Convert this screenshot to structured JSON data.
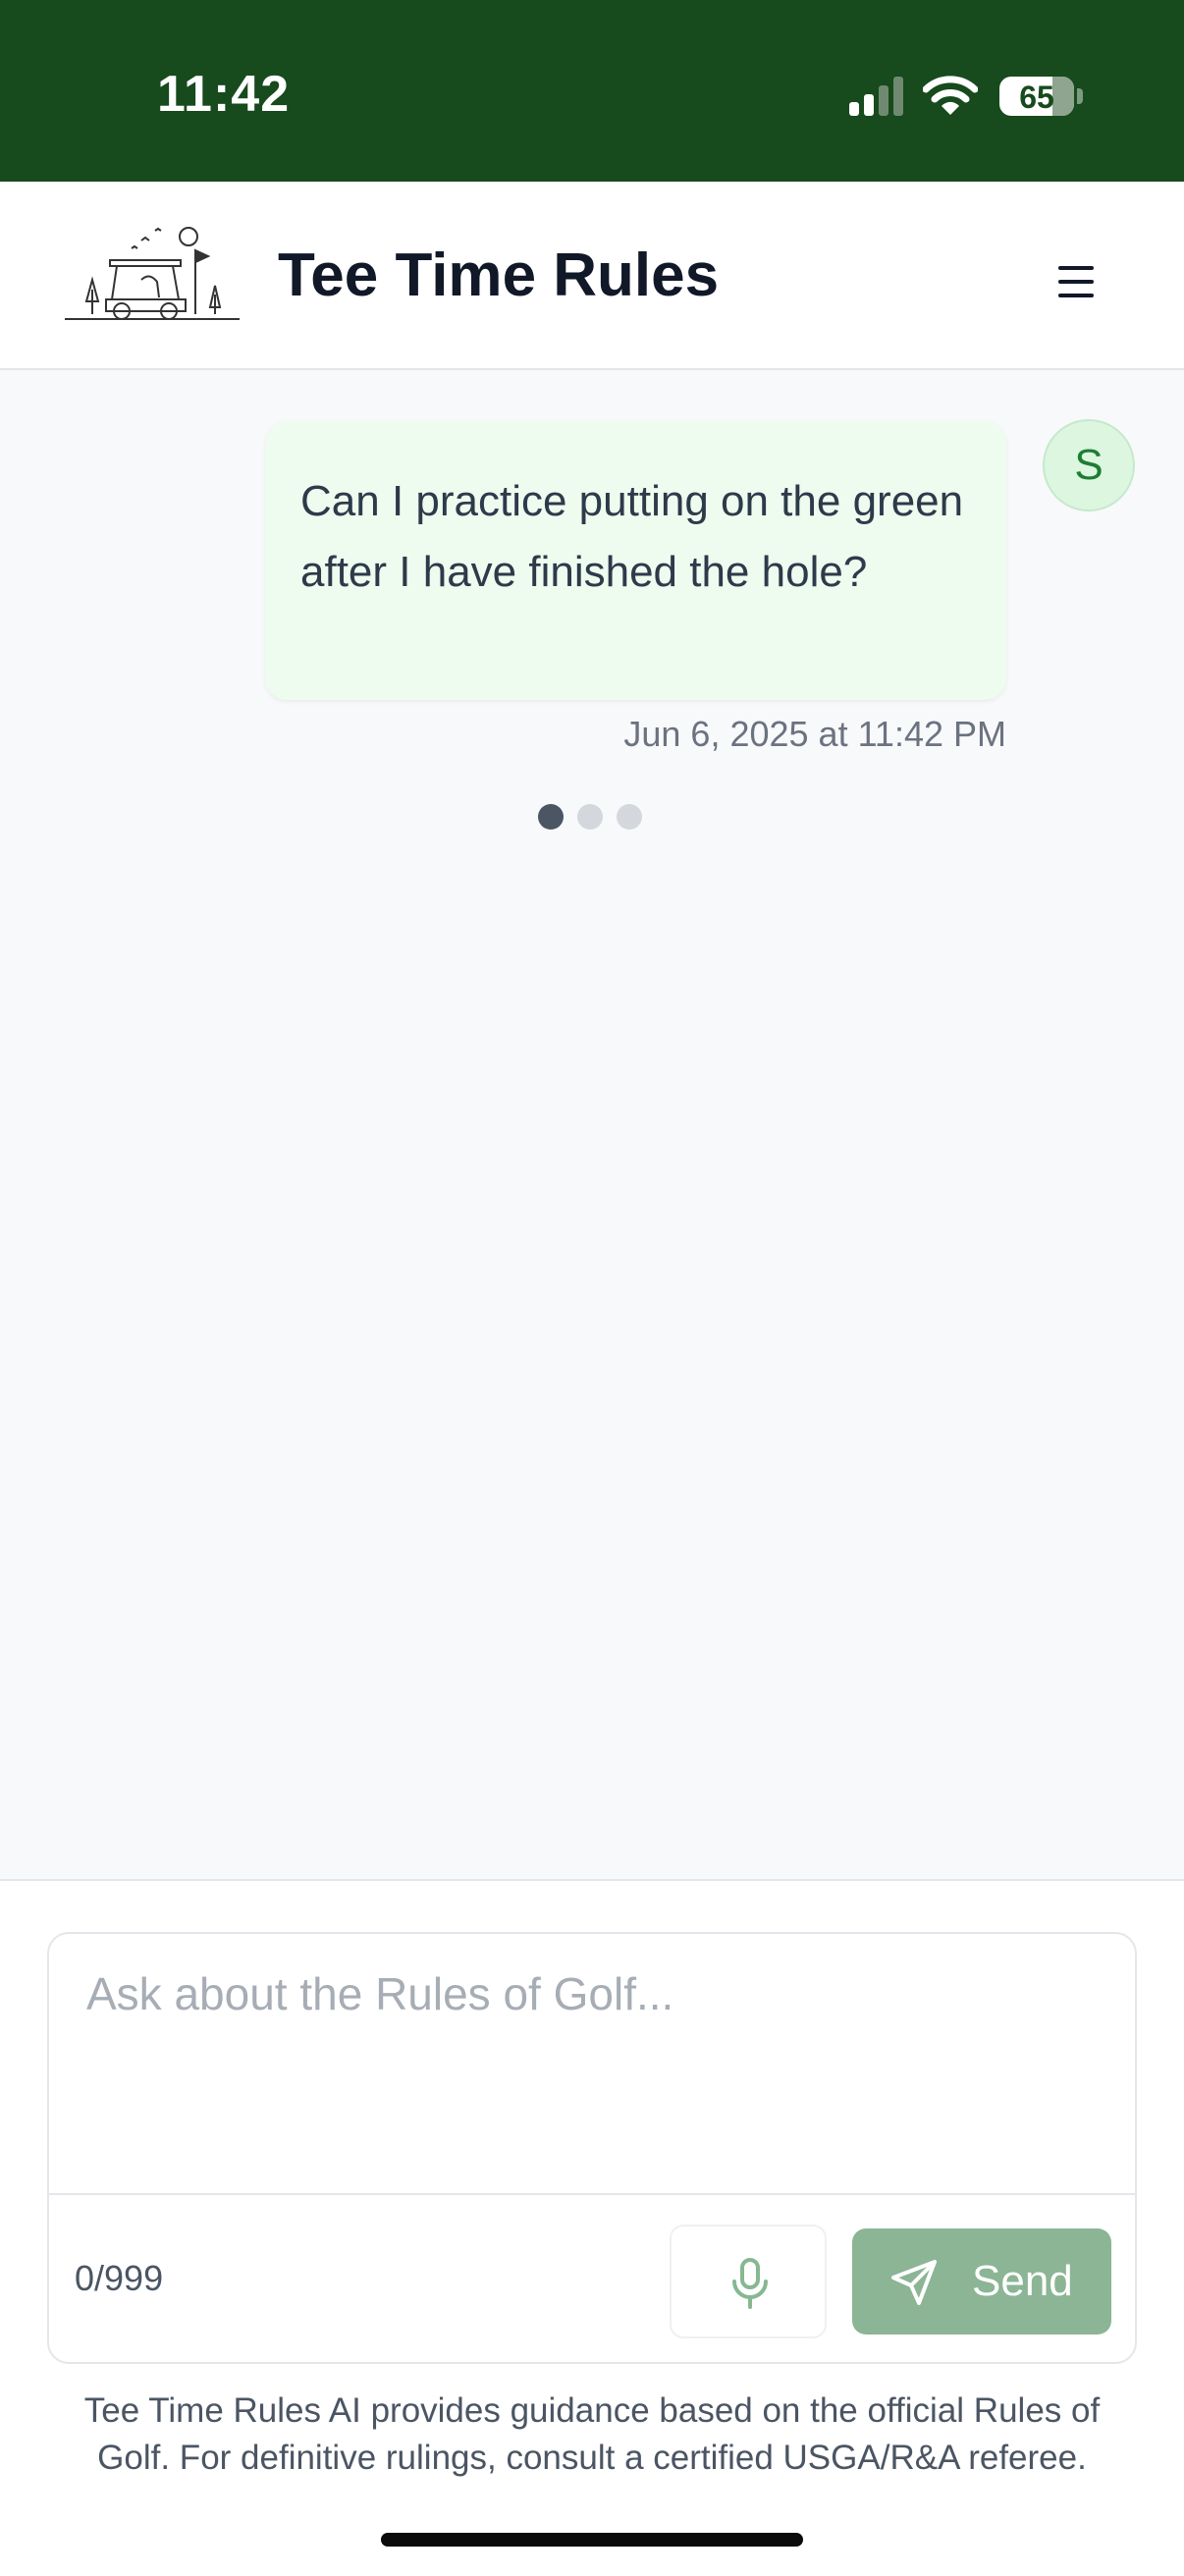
{
  "status_bar": {
    "time": "11:42",
    "battery": "65",
    "battery_level_percent": 65,
    "icons": [
      "signal-icon",
      "wifi-icon",
      "battery-icon"
    ]
  },
  "header": {
    "title": "Tee Time Rules",
    "logo": "golf-cart-logo-icon",
    "menu_icon": "hamburger-menu-icon"
  },
  "chat": {
    "messages": [
      {
        "role": "user",
        "avatar_initial": "S",
        "text": "Can I practice putting on the green after I have finished the hole?",
        "timestamp": "Jun 6, 2025 at 11:42 PM"
      }
    ],
    "typing_indicator": true
  },
  "composer": {
    "placeholder": "Ask about the Rules of Golf...",
    "value": "",
    "char_count": "0/999",
    "mic_icon": "microphone-icon",
    "send_icon": "paper-plane-icon",
    "send_label": "Send"
  },
  "disclaimer": "Tee Time Rules AI provides guidance based on the official Rules of Golf. For definitive rulings, consult a certified USGA/R&A referee.",
  "colors": {
    "status_bar_bg": "#174a1c",
    "user_bubble_bg": "#eefbef",
    "avatar_bg": "#dcf6df",
    "send_button_bg": "#8bb595"
  }
}
